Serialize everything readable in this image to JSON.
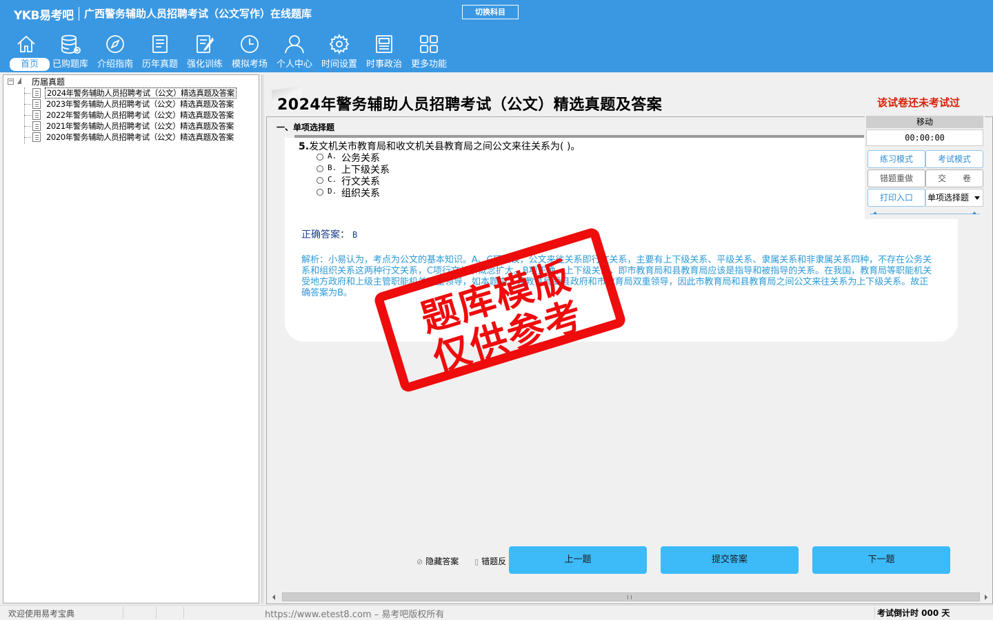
{
  "app": {
    "logo": "YKB易考吧",
    "title": "广西警务辅助人员招聘考试（公文写作）在线题库",
    "switch_subject": "切换科目"
  },
  "nav": [
    {
      "label": "首页",
      "icon": "home-icon",
      "active": true
    },
    {
      "label": "已购题库",
      "icon": "database-icon"
    },
    {
      "label": "介绍指南",
      "icon": "compass-icon"
    },
    {
      "label": "历年真题",
      "icon": "list-icon"
    },
    {
      "label": "强化训练",
      "icon": "edit-icon"
    },
    {
      "label": "模拟考场",
      "icon": "clock-icon"
    },
    {
      "label": "个人中心",
      "icon": "user-icon"
    },
    {
      "label": "时间设置",
      "icon": "gear-icon"
    },
    {
      "label": "时事政治",
      "icon": "newspaper-icon"
    },
    {
      "label": "更多功能",
      "icon": "grid-icon"
    }
  ],
  "tree": {
    "root": "历届真题",
    "items": [
      "2024年警务辅助人员招聘考试（公文）精选真题及答案",
      "2023年警务辅助人员招聘考试（公文）精选真题及答案",
      "2022年警务辅助人员招聘考试（公文）精选真题及答案",
      "2021年警务辅助人员招聘考试（公文）精选真题及答案",
      "2020年警务辅助人员招聘考试（公文）精选真题及答案"
    ]
  },
  "paper": {
    "title": "2024年警务辅助人员招聘考试（公文）精选真题及答案",
    "status": "该试卷还未考试过"
  },
  "section_title": "一、单项选择题",
  "question": {
    "number": "5.",
    "stem": "发文机关市教育局和收文机关县教育局之间公文来往关系为( )。",
    "options": [
      {
        "letter": "A.",
        "text": "公务关系"
      },
      {
        "letter": "B.",
        "text": "上下级关系"
      },
      {
        "letter": "C.",
        "text": "行文关系"
      },
      {
        "letter": "D.",
        "text": "组织关系"
      }
    ],
    "answer_label": "正确答案：",
    "answer_value": "B",
    "analysis": "解析：小易认为，考点为公文的基本知识。A、C项错误，公文来往关系即行文关系，主要有上下级关系、平级关系、隶属关系和非隶属关系四种，不存在公务关系和组织关系这两种行文关系，C项行文关系概念扩大。B项正确，上下级关系，即市教育局和县教育局应该是指导和被指导的关系。在我国，教育局等职能机关受地方政府和上级主管职能机关双重领导，如本题中，县教育局受县政府和市教育局双重领导，因此市教育局和县教育局之间公文来往关系为上下级关系。故正确答案为B。"
  },
  "panel": {
    "move": "移动",
    "timer": "00:00:00",
    "practice_mode": "练习模式",
    "exam_mode": "考试模式",
    "redo_wrong": "错题重做",
    "submit_paper": "交　　卷",
    "print": "打印入口",
    "type_select": "单项选择题"
  },
  "bottom": {
    "hide_answer": "隐藏答案",
    "error_feedback": "错题反",
    "prev": "上一题",
    "submit": "提交答案",
    "next": "下一题"
  },
  "status": {
    "welcome": "欢迎使用易考宝典",
    "copyright": "https://www.etest8.com – 易考吧版权所有",
    "countdown": "考试倒计时 000 天"
  },
  "stamp": {
    "line1": "题库模版",
    "line2": "仅供参考"
  },
  "colors": {
    "brand_blue": "#3a98e3",
    "button_blue": "#3dbaf8",
    "analysis_text": "#2f9bd6",
    "answer_text": "#1a3c8c",
    "status_red": "#d81e06",
    "stamp_red": "#ee0000"
  }
}
